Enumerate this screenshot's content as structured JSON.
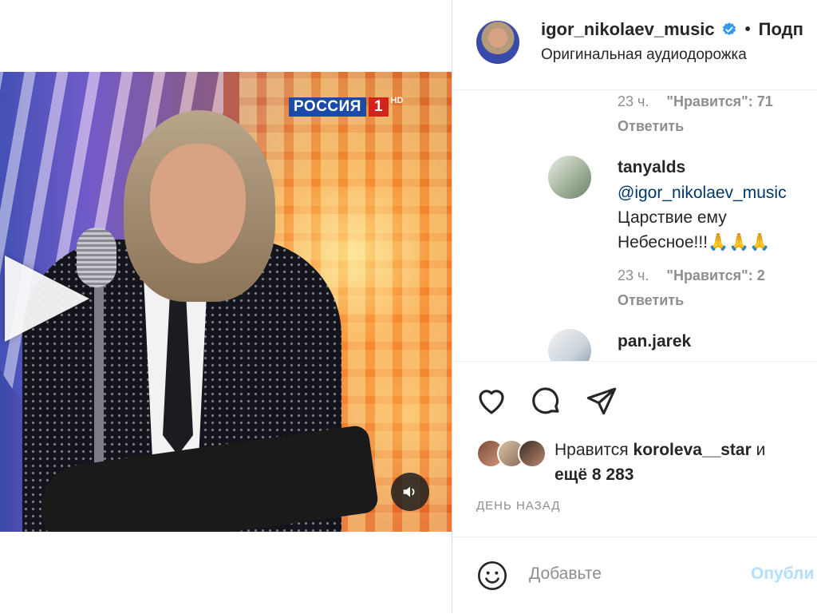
{
  "video": {
    "channel_name": "РОССИЯ",
    "channel_number": "1",
    "channel_hd": "HD"
  },
  "header": {
    "username": "igor_nikolaev_music",
    "separator": "•",
    "follow_label": "Подп",
    "audio_label": "Оригинальная аудиодорожка"
  },
  "comments": {
    "top": {
      "time": "23 ч.",
      "likes": "\"Нравится\": 71",
      "reply": "Ответить"
    },
    "items": [
      {
        "username": "tanyalds",
        "mention": "@igor_nikolaev_music",
        "text_line1": "Царствие ему",
        "text_line2": "Небесное!!!🙏🙏🙏",
        "time": "23 ч.",
        "likes": "\"Нравится\": 2",
        "reply": "Ответить"
      },
      {
        "username": "pan.jarek"
      }
    ]
  },
  "likes": {
    "prefix": "Нравится",
    "user": "koroleva__star",
    "suffix": "и",
    "more": "ещё 8 283"
  },
  "date": "ДЕНЬ НАЗАД",
  "add_comment": {
    "placeholder": "Добавьте",
    "publish_label": "Опубли"
  },
  "colors": {
    "verified": "#3897f0",
    "mention": "#00376b",
    "muted": "#8e8e8e",
    "publish_disabled": "#b2dffc"
  }
}
